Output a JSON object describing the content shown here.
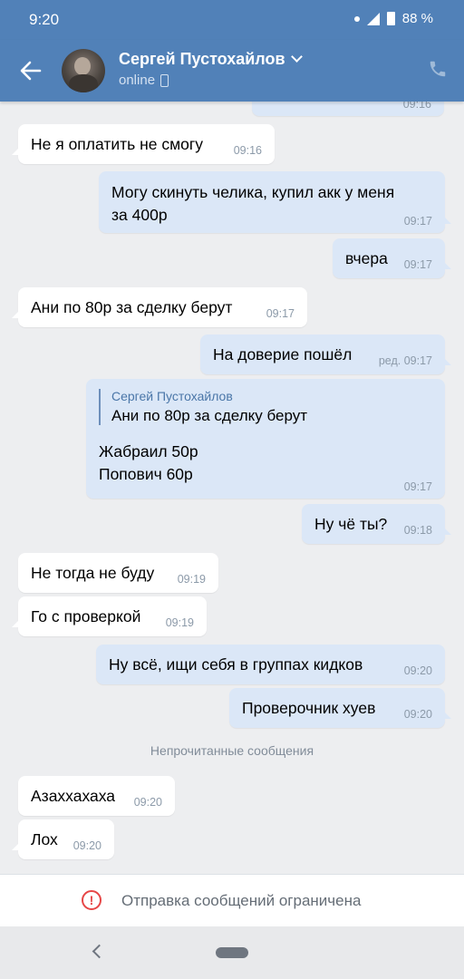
{
  "status_bar": {
    "time": "9:20",
    "battery": "88 %"
  },
  "header": {
    "name": "Сергей Пустохайлов",
    "status": "online"
  },
  "messages": [
    {
      "dir": "out",
      "text": "",
      "time": "09:16"
    },
    {
      "dir": "in",
      "text": "Не я оплатить не смогу",
      "time": "09:16"
    },
    {
      "dir": "out",
      "lines": [
        "Могу скинуть челика, купил акк у меня",
        "за 400р"
      ],
      "time": "09:17"
    },
    {
      "dir": "out",
      "text": "вчера",
      "time": "09:17"
    },
    {
      "dir": "in",
      "text": "Ани по 80р за сделку берут",
      "time": "09:17"
    },
    {
      "dir": "out",
      "text": "На доверие пошёл",
      "time": "ред. 09:17"
    },
    {
      "dir": "out",
      "quote": {
        "author": "Сергей Пустохайлов",
        "text": "Ани по 80р за сделку берут"
      },
      "lines": [
        "Жабраил 50р",
        "Попович 60р"
      ],
      "time": "09:17"
    },
    {
      "dir": "out",
      "text": "Ну чё ты?",
      "time": "09:18"
    },
    {
      "dir": "in",
      "text": "Не тогда не буду",
      "time": "09:19"
    },
    {
      "dir": "in",
      "text": "Го с проверкой",
      "time": "09:19"
    },
    {
      "dir": "out",
      "text": "Ну всё, ищи себя в группах кидков",
      "time": "09:20"
    },
    {
      "dir": "out",
      "text": "Проверочник хуев",
      "time": "09:20"
    },
    {
      "dir": "in",
      "text": "Азаххахаха",
      "time": "09:20"
    },
    {
      "dir": "in",
      "text": "Лох",
      "time": "09:20"
    }
  ],
  "unread_divider": "Непрочитанные сообщения",
  "footer": {
    "notice": "Отправка сообщений ограничена"
  },
  "icons": {
    "back": "arrow-left-icon",
    "call": "phone-icon",
    "warning": "alert-circle-icon"
  },
  "colors": {
    "header": "#5181b8",
    "outgoing": "#dbe7f7",
    "incoming": "#ffffff",
    "background": "#edeef0",
    "warning": "#e64646"
  }
}
